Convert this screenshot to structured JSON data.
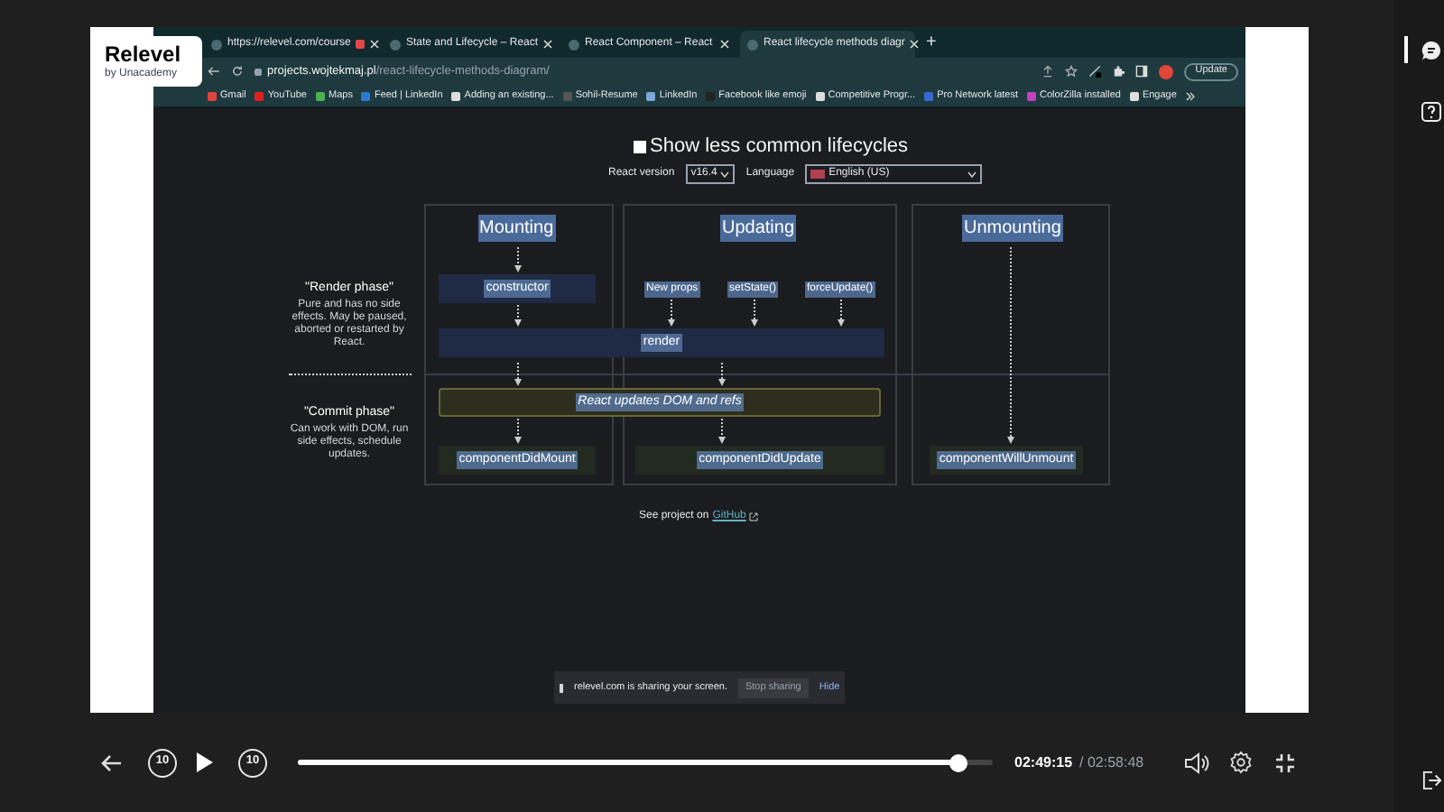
{
  "logo": {
    "name": "Relevel",
    "tagline": "by Unacademy"
  },
  "browser": {
    "tabs": [
      {
        "title": "https://relevel.com/course",
        "selected": false,
        "recording": true
      },
      {
        "title": "State and Lifecycle – React",
        "selected": false,
        "recording": false
      },
      {
        "title": "React Component – React",
        "selected": false,
        "recording": false
      },
      {
        "title": "React lifecycle methods diagr",
        "selected": true,
        "recording": false
      }
    ],
    "new_tab": "+",
    "url_host": "projects.wojtekmaj.pl",
    "url_path": "/react-lifecycle-methods-diagram/",
    "update_button": "Update",
    "bookmarks": [
      "Gmail",
      "YouTube",
      "Maps",
      "Feed | LinkedIn",
      "Adding an existing...",
      "Sohil-Resume",
      "LinkedIn",
      "Facebook like emoji",
      "Competitive Progr...",
      "Pro Network latest",
      "ColorZilla installed",
      "Engage"
    ]
  },
  "diagram": {
    "checkbox": {
      "label": "Show less common lifecycles",
      "checked": false
    },
    "react_version": {
      "label": "React version",
      "value": "v16.4"
    },
    "language": {
      "label": "Language",
      "value": "English (US)"
    },
    "columns": [
      "Mounting",
      "Updating",
      "Unmounting"
    ],
    "phases": [
      {
        "title": "\"Render phase\"",
        "description": "Pure and has no side effects. May be paused, aborted or restarted by React."
      },
      {
        "title": "\"Commit phase\"",
        "description": "Can work with DOM, run side effects, schedule updates."
      }
    ],
    "constructor": "constructor",
    "triggers": [
      "New props",
      "setState()",
      "forceUpdate()"
    ],
    "render": "render",
    "commit": "React updates DOM and refs",
    "did_mount": "componentDidMount",
    "did_update": "componentDidUpdate",
    "will_unmount": "componentWillUnmount",
    "footer_text": "See project on",
    "footer_link": "GitHub"
  },
  "share_bar": {
    "message": "relevel.com is sharing your screen.",
    "stop": "Stop sharing",
    "hide": "Hide"
  },
  "player": {
    "skip_back": "10",
    "skip_forward": "10",
    "level": 0.95,
    "time_current": "02:49:15",
    "time_total": "/ 02:58:48"
  }
}
